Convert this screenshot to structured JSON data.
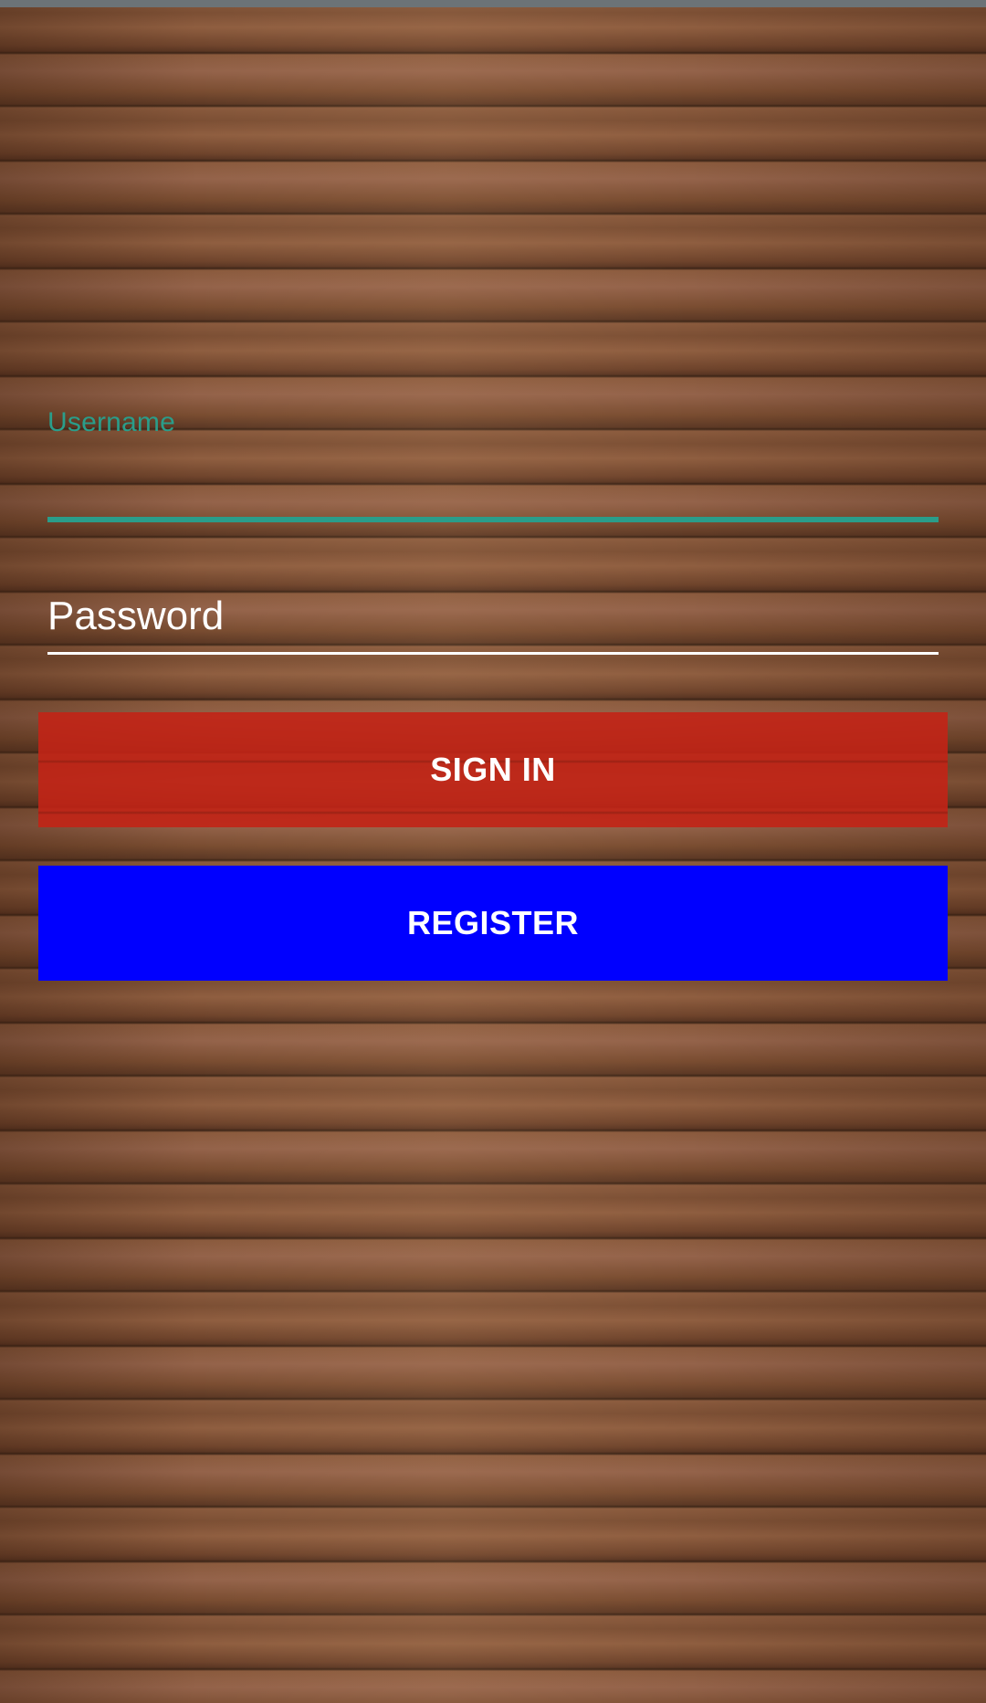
{
  "login": {
    "username": {
      "label": "Username",
      "value": ""
    },
    "password": {
      "placeholder": "Password",
      "value": ""
    },
    "sign_in_label": "SIGN IN",
    "register_label": "REGISTER"
  },
  "colors": {
    "accent": "#2a9d8a",
    "sign_in": "#c22416",
    "register": "#0000ff",
    "text": "#ffffff"
  }
}
